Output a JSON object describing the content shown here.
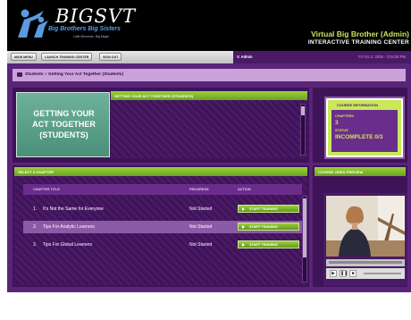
{
  "header": {
    "logo_title": "BIGSVT",
    "logo_subtitle": "Big Brothers Big Sisters",
    "logo_tagline": "Little Moments. Big Magic.",
    "app_name": "Virtual Big Brother (Admin)",
    "app_subtitle": "INTERACTIVE TRAINING CENTER"
  },
  "toolbar": {
    "main_menu": "MAIN MENU",
    "launch_training": "LAUNCH TRAINING CENTER",
    "sign_out": "SIGN OUT",
    "user_name": "V. Admin",
    "date_time": "Fri Oct 2, 2009 - 3:03:38 PM"
  },
  "breadcrumb": {
    "root": "Students",
    "separator": ">",
    "current": "Getting Your Act Together (Students)"
  },
  "course": {
    "card_title": "GETTING YOUR\nACT TOGETHER\n(STUDENTS)",
    "description_heading": "GETTING YOUR ACT TOGETHER (STUDENTS)"
  },
  "chapters": {
    "heading": "SELECT A CHAPTER",
    "columns": {
      "title": "CHAPTER TITLE",
      "progress": "PROGRESS",
      "action": "ACTION"
    },
    "rows": [
      {
        "num": "1.",
        "title": "It's Not the Same for Everyone",
        "status": "Not Started",
        "action": "START TRAINING"
      },
      {
        "num": "2.",
        "title": "Tips For Analytic Learners",
        "status": "Not Started",
        "action": "START TRAINING"
      },
      {
        "num": "3.",
        "title": "Tips For Global Learners",
        "status": "Not Started",
        "action": "START TRAINING"
      }
    ]
  },
  "course_info": {
    "heading": "COURSE INFORMATION",
    "chapters_label": "CHAPTERS",
    "chapters_value": "3",
    "status_label": "STATUS",
    "status_value": "INCOMPLETE 0/3"
  },
  "video": {
    "heading": "COURSE VIDEO PREVIEW",
    "play_icon": "▶",
    "pause_icon": "❚❚",
    "stop_icon": "■"
  },
  "colors": {
    "brand_purple": "#4a1a66",
    "accent_green": "#9bd13a",
    "highlight_row": "#8a5aa6"
  }
}
